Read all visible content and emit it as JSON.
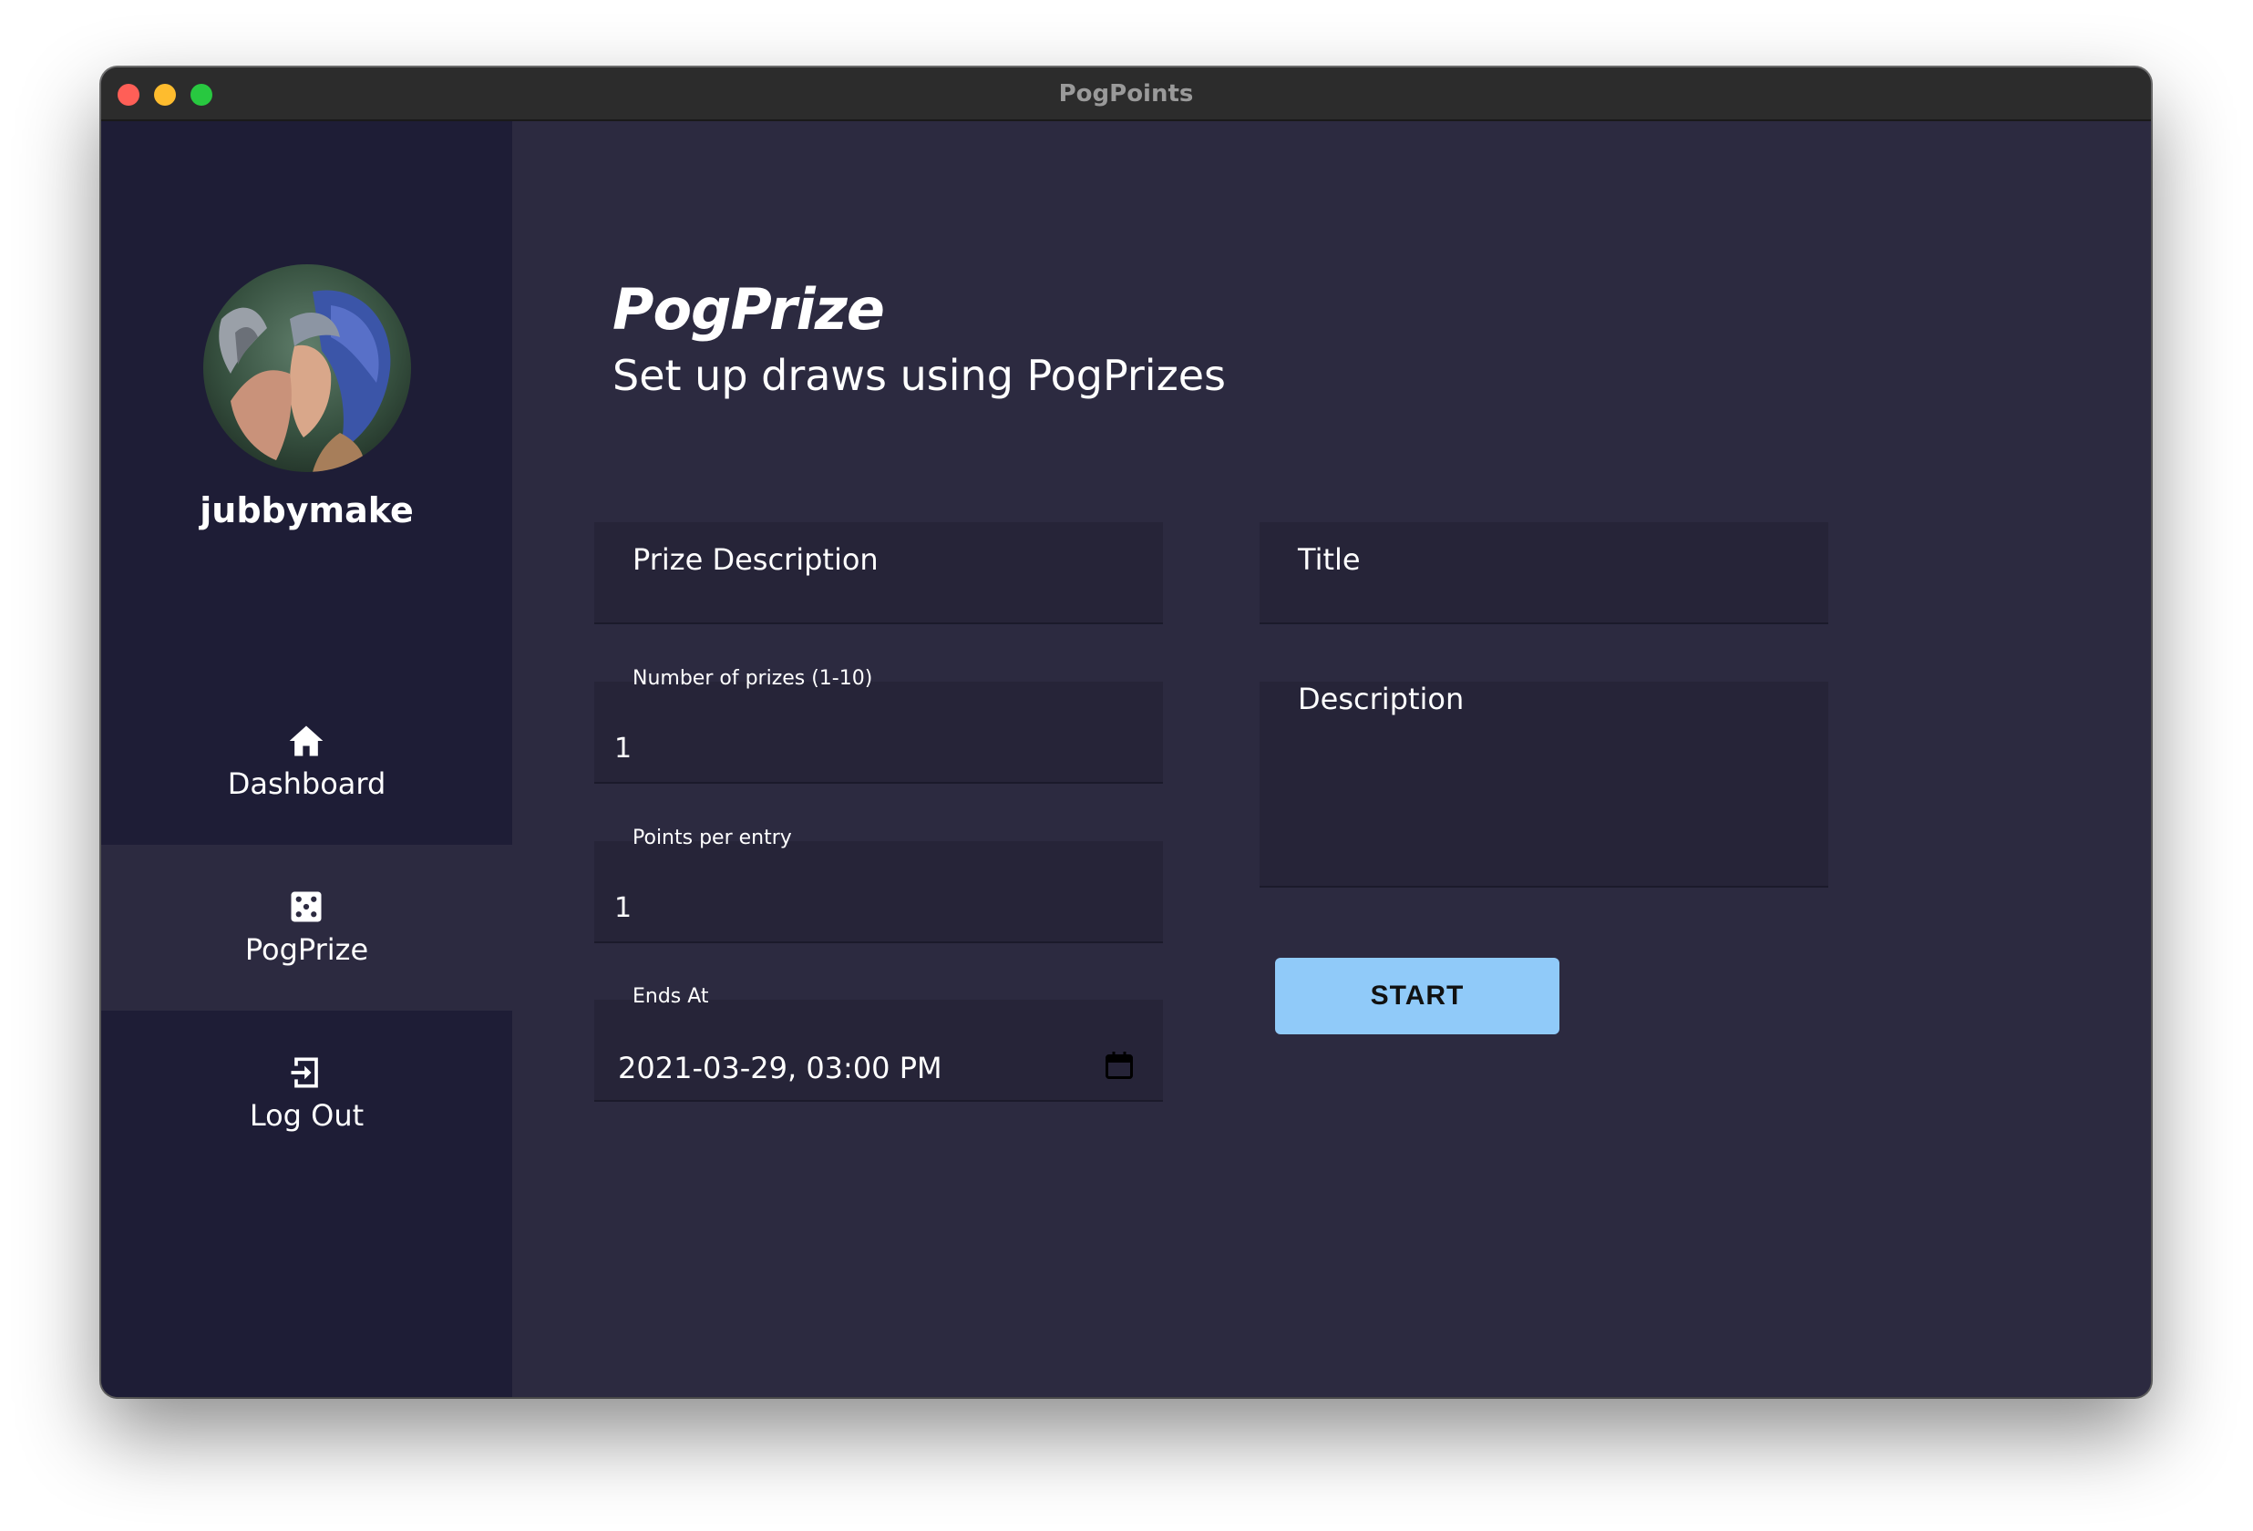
{
  "window": {
    "title": "PogPoints"
  },
  "sidebar": {
    "username": "jubbymake",
    "nav": [
      {
        "label": "Dashboard",
        "icon": "home-icon"
      },
      {
        "label": "PogPrize",
        "icon": "dice-icon",
        "active": true
      },
      {
        "label": "Log Out",
        "icon": "logout-icon"
      }
    ]
  },
  "main": {
    "title": "PogPrize",
    "subtitle": "Set up draws using PogPrizes"
  },
  "form": {
    "prize_description": {
      "label": "Prize Description",
      "value": ""
    },
    "number_of_prizes": {
      "label": "Number of prizes (1-10)",
      "value": "1"
    },
    "points_per_entry": {
      "label": "Points per entry",
      "value": "1"
    },
    "ends_at": {
      "label": "Ends At",
      "value": "2021-03-29, 03:00 PM"
    },
    "title": {
      "label": "Title",
      "value": ""
    },
    "description": {
      "label": "Description",
      "value": ""
    },
    "start_label": "START"
  },
  "colors": {
    "sidebar_bg": "#1e1d36",
    "main_bg": "#2c2a40",
    "field_bg": "#262438",
    "accent": "#90caf9"
  }
}
